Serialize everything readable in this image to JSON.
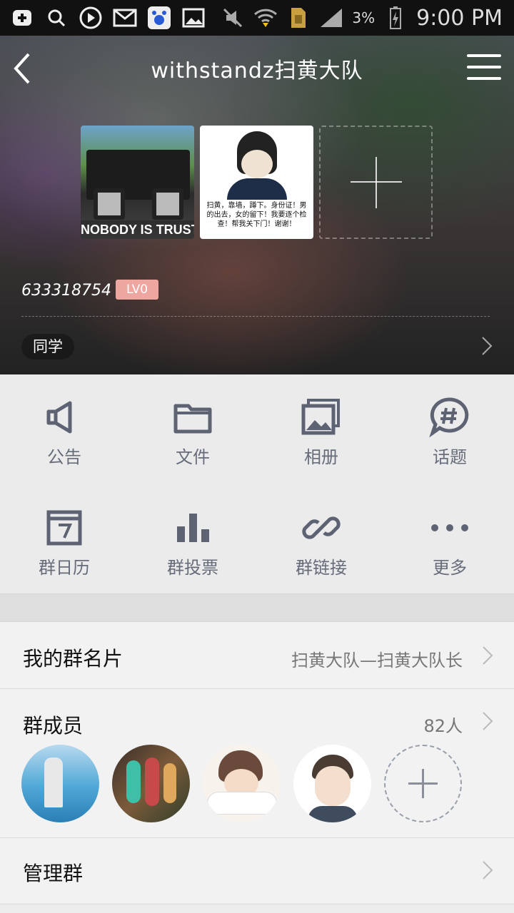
{
  "status_bar": {
    "battery_percent": "3%",
    "time": "9:00 PM"
  },
  "header": {
    "title": "withstandz扫黄大队",
    "photos": [
      {
        "caption": "NOBODY IS TRUST"
      },
      {
        "caption": "扫黄，靠墙，蹲下。身份证！男的出去，女的留下！我要逐个检查！帮我关下门！谢谢！"
      }
    ],
    "group_id": "633318754",
    "level": "LV0",
    "tag": "同学"
  },
  "grid": {
    "items": [
      {
        "label": "公告",
        "icon": "megaphone-icon"
      },
      {
        "label": "文件",
        "icon": "folder-icon"
      },
      {
        "label": "相册",
        "icon": "album-icon"
      },
      {
        "label": "话题",
        "icon": "topic-hashtag-icon"
      },
      {
        "label": "群日历",
        "icon": "calendar-icon"
      },
      {
        "label": "群投票",
        "icon": "poll-bars-icon"
      },
      {
        "label": "群链接",
        "icon": "link-icon"
      },
      {
        "label": "更多",
        "icon": "more-dots-icon"
      }
    ]
  },
  "group_card": {
    "label": "我的群名片",
    "value": "扫黄大队—扫黄大队长"
  },
  "members": {
    "label": "群成员",
    "count": "82人"
  },
  "manage": {
    "label": "管理群"
  },
  "colors": {
    "icon_gray": "#5d6373",
    "level_badge": "#eea7a0"
  }
}
